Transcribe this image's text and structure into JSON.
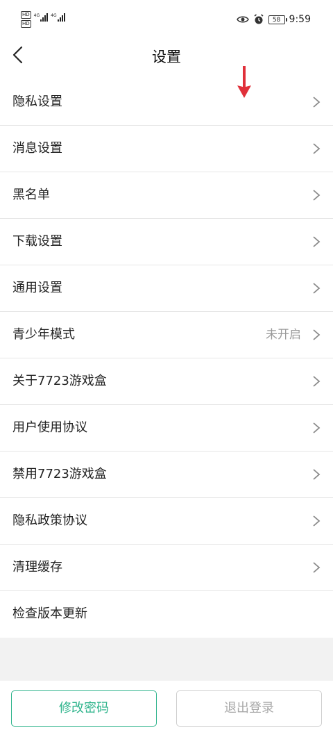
{
  "status_bar": {
    "hd1": "HD",
    "hd2": "HD",
    "net1": "4G",
    "net2": "4G",
    "battery": "58",
    "time": "9:59"
  },
  "header": {
    "title": "设置"
  },
  "menu": [
    {
      "label": "隐私设置",
      "value": ""
    },
    {
      "label": "消息设置",
      "value": ""
    },
    {
      "label": "黑名单",
      "value": ""
    },
    {
      "label": "下载设置",
      "value": ""
    },
    {
      "label": "通用设置",
      "value": ""
    },
    {
      "label": "青少年模式",
      "value": "未开启"
    },
    {
      "label": "关于7723游戏盒",
      "value": ""
    },
    {
      "label": "用户使用协议",
      "value": ""
    },
    {
      "label": "禁用7723游戏盒",
      "value": ""
    },
    {
      "label": "隐私政策协议",
      "value": ""
    },
    {
      "label": "清理缓存",
      "value": ""
    },
    {
      "label": "检查版本更新",
      "value": ""
    }
  ],
  "buttons": {
    "change_password": "修改密码",
    "logout": "退出登录"
  },
  "colors": {
    "accent": "#2fb48c",
    "annotation_arrow": "#e0303a"
  }
}
